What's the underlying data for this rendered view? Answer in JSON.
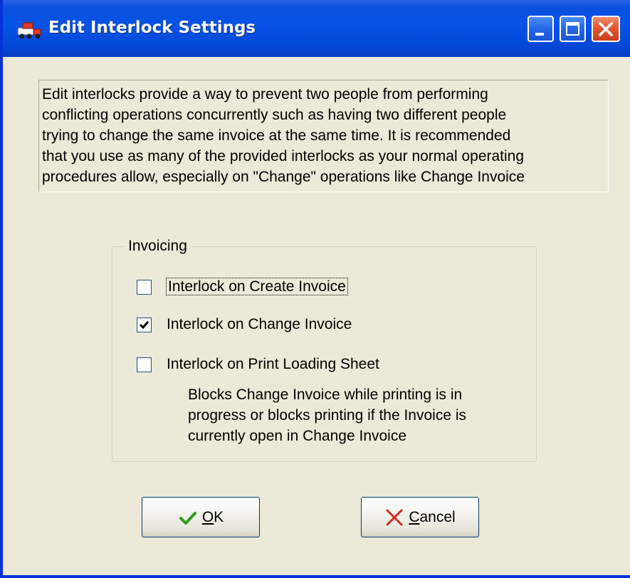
{
  "window": {
    "title": "Edit Interlock Settings",
    "icon": "truck-icon",
    "controls": [
      "minimize",
      "maximize",
      "close"
    ]
  },
  "description": {
    "lines": [
      "Edit interlocks provide a way to prevent two people from performing",
      "conflicting operations concurrently such as having two different people",
      "trying to change the same invoice at the same time. It is recommended",
      "that you use as many of the provided interlocks as your normal operating",
      "procedures allow, especially on \"Change\" operations like Change Invoice"
    ]
  },
  "invoicing": {
    "group_label": "Invoicing",
    "options": [
      {
        "label": "Interlock on Create Invoice",
        "checked": false
      },
      {
        "label": "Interlock on Change Invoice",
        "checked": true
      },
      {
        "label": "Interlock on Print Loading Sheet",
        "checked": false
      }
    ],
    "note_lines": [
      "Blocks Change Invoice while printing is in",
      "progress or blocks printing if the Invoice is",
      "currently open in Change Invoice"
    ]
  },
  "buttons": {
    "ok": {
      "mnemonic": "O",
      "rest": "K",
      "icon": "checkmark-icon"
    },
    "cancel": {
      "mnemonic": "C",
      "rest": "ancel",
      "icon": "x-icon"
    }
  },
  "colors": {
    "titlebar": "#0654e6",
    "window_bg": "#ece9d8",
    "ok_icon": "#2e9a1e",
    "cancel_icon": "#d42a1a"
  }
}
